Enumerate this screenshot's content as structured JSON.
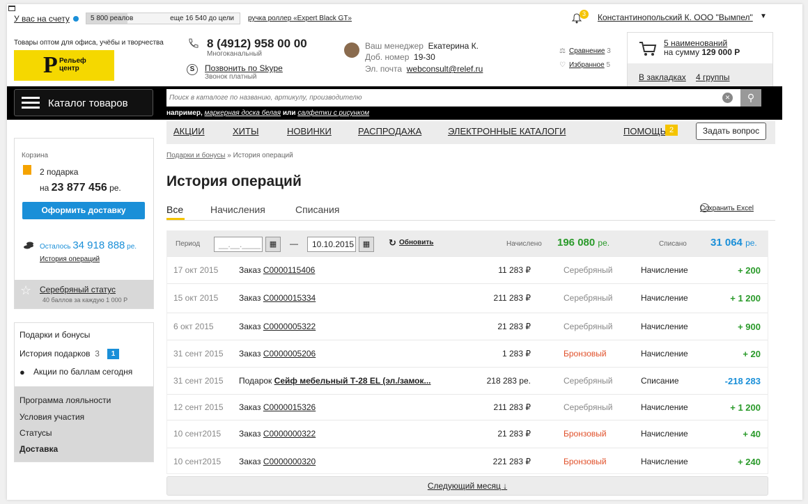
{
  "topbar": {
    "account_label": "У вас на счету",
    "balance": "5 800 реалов",
    "balance_fraction": 0.27,
    "to_goal": "еще 16 540 до цели",
    "goal_link": "ручка роллер «Expert Black GT»",
    "notifications": "3",
    "user": "Константинопольский К.  ООО \"Вымпел\""
  },
  "header": {
    "tagline": "Товары оптом для офиса, учёбы и творчества",
    "logo_letter": "Р",
    "logo_text1": "Рельеф",
    "logo_text2": "центр",
    "phone": "8 (4912) 958 00 00",
    "phone_sub": "Многоканальный",
    "skype_link": "Позвонить по Skype",
    "skype_sub": "Звонок платный",
    "manager_label": "Ваш менеджер",
    "manager_name": "Екатерина К.",
    "ext_label": "Доб. номер",
    "ext": "19-30",
    "email_label": "Эл. почта",
    "email": "webconsult@relef.ru",
    "compare_label": "Сравнение",
    "compare_count": "3",
    "favorites_label": "Избранное",
    "favorites_count": "5",
    "cart_items": "5 наименований",
    "cart_sum_label": "на сумму",
    "cart_sum": "129 000 Р",
    "bookmarks_label": "В закладках",
    "bookmarks_groups": "4 группы"
  },
  "search": {
    "catalog_btn": "Каталог товаров",
    "placeholder": "Поиск в каталоге по названию, артикулу, производителю",
    "example_prefix": "например,",
    "example1": "маркерная доска белая",
    "example_or": "или",
    "example2": "салфетки с рисунком"
  },
  "nav": {
    "items": [
      "АКЦИИ",
      "ХИТЫ",
      "НОВИНКИ",
      "РАСПРОДАЖА",
      "ЭЛЕКТРОННЫЕ КАТАЛОГИ"
    ],
    "help": "ПОМОЩЬ",
    "help_count": "2",
    "ask": "Задать вопрос"
  },
  "sidebar": {
    "cart_title": "Корзина",
    "gifts": "2 подарка",
    "sum_prefix": "на",
    "sum": "23 877 456",
    "sum_unit": "ре.",
    "deliver_btn": "Оформить доставку",
    "left_label": "Осталось",
    "left_value": "34 918 888",
    "left_unit": "ре.",
    "history_link": "История операций",
    "status": "Серебряный статус",
    "status_sub": "40 баллов за каждую 1 000 Р",
    "menu": {
      "gifts_bonuses": "Подарки и бонусы",
      "gift_history": "История подарков",
      "gift_history_count": "3",
      "gift_history_new": "1",
      "promo": "Акции по баллам сегодня",
      "loyalty": "Программа лояльности",
      "conditions": "Условия участия",
      "statuses": "Статусы",
      "delivery": "Доставка"
    }
  },
  "main": {
    "crumb1": "Подарки и бонусы",
    "crumb_sep": "»",
    "crumb2": "История операций",
    "title": "История операций",
    "tabs": [
      "Все",
      "Начисления",
      "Списания"
    ],
    "excel": "Сохранить Excel",
    "period_label": "Период",
    "date_from": "__.__.____",
    "date_to": "10.10.2015",
    "refresh": "Обновить",
    "accrued_label": "Начислено",
    "accrued_value": "196 080",
    "accrued_unit": "ре.",
    "spent_label": "Списано",
    "spent_value": "31 064",
    "spent_unit": "ре.",
    "rows": [
      {
        "date": "17 окт 2015",
        "kind": "Заказ",
        "doc": "С0000115406",
        "sum": "11 283 ₽",
        "status": "Серебряный",
        "type": "Начисление",
        "amount": "+ 200"
      },
      {
        "date": "15 окт 2015",
        "kind": "Заказ",
        "doc": "С0000015334",
        "sum": "211 283 ₽",
        "status": "Серебряный",
        "type": "Начисление",
        "amount": "+ 1 200"
      },
      {
        "date": "6 окт 2015",
        "kind": "Заказ",
        "doc": "С0000005322",
        "sum": "21 283 ₽",
        "status": "Серебряный",
        "type": "Начисление",
        "amount": "+ 900"
      },
      {
        "date": "31 сент 2015",
        "kind": "Заказ",
        "doc": "С0000005206",
        "sum": "1 283 ₽",
        "status": "Бронзовый",
        "type": "Начисление",
        "amount": "+ 20"
      },
      {
        "date": "31 сент 2015",
        "kind": "Подарок",
        "doc": "Сейф мебельный Т-28 EL (эл./замок...",
        "sum": "218 283 ре.",
        "status": "Серебряный",
        "type": "Списание",
        "amount": "-218 283"
      },
      {
        "date": "12 сент 2015",
        "kind": "Заказ",
        "doc": "С0000015326",
        "sum": "211 283 ₽",
        "status": "Серебряный",
        "type": "Начисление",
        "amount": "+ 1 200"
      },
      {
        "date": "10 сент2015",
        "kind": "Заказ",
        "doc": "С0000000322",
        "sum": "21 283 ₽",
        "status": "Бронзовый",
        "type": "Начисление",
        "amount": "+ 40"
      },
      {
        "date": "10 сент2015",
        "kind": "Заказ",
        "doc": "С0000000320",
        "sum": "221 283 ₽",
        "status": "Бронзовый",
        "type": "Начисление",
        "amount": "+ 240"
      }
    ],
    "next_month": "Следующий месяц ↓"
  },
  "colors": {
    "accent_blue": "#1a8fd8",
    "accent_yellow": "#f5c400",
    "positive": "#2a9a2a",
    "bronze": "#e0502a"
  }
}
